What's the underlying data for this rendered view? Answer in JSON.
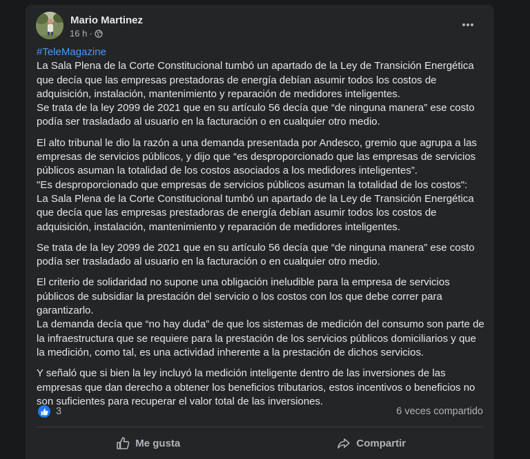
{
  "post": {
    "author": "Mario Martinez",
    "time": "16 h",
    "separator": "·",
    "audience_icon": "globe-icon",
    "hashtag": "#TeleMagazine",
    "paragraphs": [
      "La Sala Plena de la Corte Constitucional tumbó un apartado de la Ley de Transición Energética que decía que las empresas prestadoras de energía debían asumir todos los costos de adquisición, instalación, mantenimiento y reparación de medidores inteligentes.\nSe trata de la ley 2099 de 2021 que en su artículo 56 decía que “de ninguna manera” ese costo podía ser trasladado al usuario en la facturación o en cualquier otro medio.",
      "El alto tribunal le dio la razón a una demanda presentada por Andesco, gremio que agrupa a las empresas de servicios públicos, y dijo que “es desproporcionado que las empresas de servicios públicos asuman la totalidad de los costos asociados a los medidores inteligentes”.\n\"Es desproporcionado que empresas de servicios públicos asuman la totalidad de los costos\":\nLa Sala Plena de la Corte Constitucional tumbó un apartado de la Ley de Transición Energética que decía que las empresas prestadoras de energía debían asumir todos los costos de adquisición, instalación, mantenimiento y reparación de medidores inteligentes.",
      "Se trata de la ley 2099 de 2021 que en su artículo 56 decía que “de ninguna manera” ese costo podía ser trasladado al usuario en la facturación o en cualquier otro medio.",
      "El criterio de solidaridad no supone una obligación ineludible para la empresa de servicios públicos de subsidiar la prestación del servicio o los costos con los que debe correr para garantizarlo.\nLa demanda decía que “no hay duda” de que los sistemas de medición del consumo son parte de la infraestructura que se requiere para la prestación de los servicios públicos domiciliarios y que la medición, como tal, es una actividad inherente a la prestación de dichos servicios.",
      "Y señaló que si bien la ley incluyó la medición inteligente dentro de las inversiones de las empresas que dan derecho a obtener los beneficios tributarios, estos incentivos o beneficios no son suficientes para recuperar el valor total de las inversiones."
    ],
    "reaction_count": "3",
    "shares": "6 veces compartido",
    "like_label": "Me gusta",
    "share_label": "Compartir"
  },
  "colors": {
    "background": "#18191a",
    "card": "#242526",
    "link": "#4599ff",
    "like_badge": "#2078f4"
  }
}
